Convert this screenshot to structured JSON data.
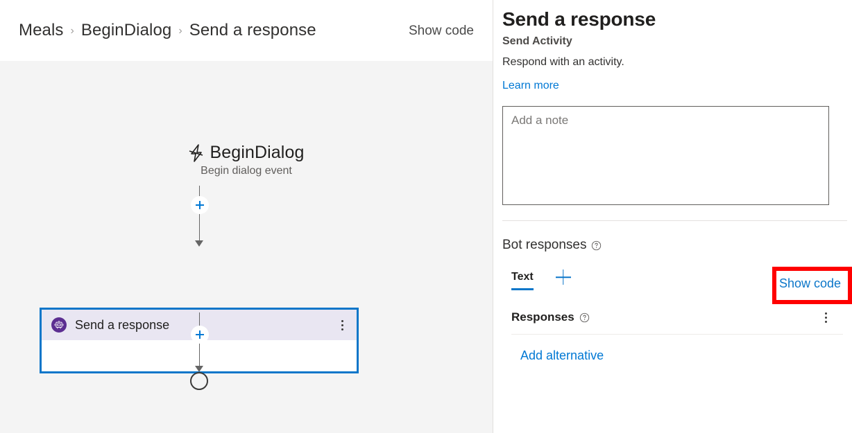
{
  "breadcrumb": {
    "items": [
      {
        "label": "Meals"
      },
      {
        "label": "BeginDialog"
      },
      {
        "label": "Send a response"
      }
    ],
    "separator": "›",
    "show_code_label": "Show code"
  },
  "canvas": {
    "trigger": {
      "icon": "lightning-bolt-icon",
      "title": "BeginDialog",
      "subtitle": "Begin dialog event"
    },
    "action_node": {
      "icon": "bot-icon",
      "label": "Send a response",
      "menu_icon": "kebab-menu-icon",
      "selected": true
    },
    "add_button_label": "+",
    "end_node": "end-of-flow-node"
  },
  "panel": {
    "title": "Send a response",
    "subtitle": "Send Activity",
    "description": "Respond with an activity.",
    "learn_more": "Learn more",
    "note": {
      "value": "",
      "placeholder": "Add a note"
    },
    "bot_responses": {
      "label": "Bot responses",
      "help_icon": "help-circle-icon",
      "show_code": "Show code",
      "tabs": [
        {
          "label": "Text",
          "active": true
        }
      ],
      "add_tab_icon": "plus-icon"
    },
    "responses": {
      "label": "Responses",
      "help_icon": "help-circle-icon",
      "menu_icon": "kebab-menu-icon",
      "add_alternative": "Add alternative"
    }
  },
  "colors": {
    "accent_blue": "#0b76c9",
    "link_blue": "#0078d4",
    "bot_purple": "#5c2e91",
    "node_header_lavender": "#e9e6f2",
    "canvas_gray": "#f4f4f4",
    "annotation_red": "#ff0000"
  }
}
